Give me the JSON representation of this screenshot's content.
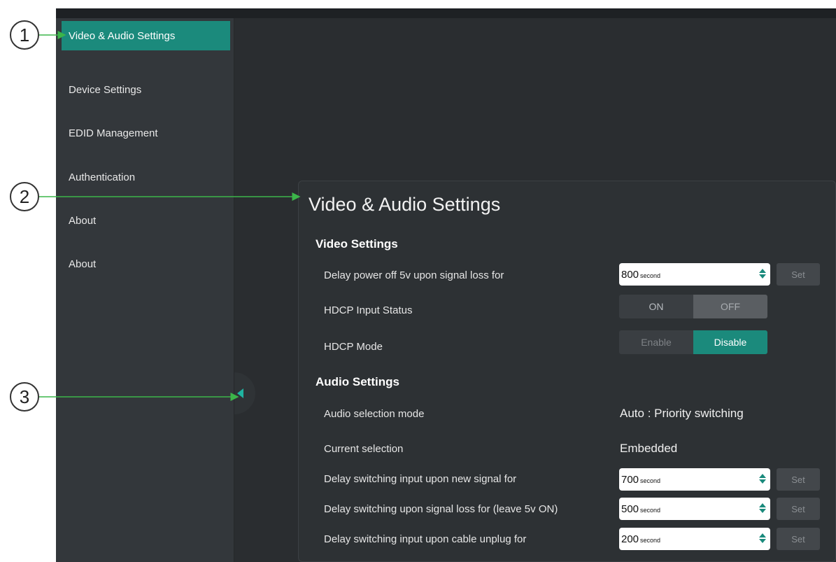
{
  "callouts": [
    "1",
    "2",
    "3"
  ],
  "sidebar": {
    "items": [
      {
        "label": "Video & Audio Settings"
      },
      {
        "label": "Device Settings"
      },
      {
        "label": "EDID Management"
      },
      {
        "label": "Authentication"
      },
      {
        "label": "About"
      },
      {
        "label": "About"
      }
    ]
  },
  "main": {
    "title": "Video & Audio Settings",
    "video": {
      "title": "Video Settings",
      "delay_power_off": {
        "label": "Delay power off 5v upon signal loss for",
        "value": "800",
        "unit": "second",
        "button": "Set"
      },
      "hdcp_input_status": {
        "label": "HDCP Input Status",
        "on": "ON",
        "off": "OFF"
      },
      "hdcp_mode": {
        "label": "HDCP Mode",
        "enable": "Enable",
        "disable": "Disable"
      }
    },
    "audio": {
      "title": "Audio Settings",
      "selection_mode": {
        "label": "Audio selection mode",
        "value": "Auto : Priority switching"
      },
      "current_selection": {
        "label": "Current selection",
        "value": "Embedded"
      },
      "delay_new_signal": {
        "label": "Delay switching input upon new signal for",
        "value": "700",
        "unit": "second",
        "button": "Set"
      },
      "delay_signal_loss": {
        "label": "Delay switching upon signal loss for (leave 5v ON)",
        "value": "500",
        "unit": "second",
        "button": "Set"
      },
      "delay_cable_unplug": {
        "label": "Delay switching input upon cable unplug for",
        "value": "200",
        "unit": "second",
        "button": "Set"
      }
    }
  },
  "colors": {
    "accent": "#1b8a7c",
    "callout_arrow": "#3cb54a",
    "sidebar_bg": "#33373b",
    "panel_bg": "#2d3134"
  },
  "icons": {
    "spinner": "updown-spinner-icon",
    "collapse": "collapse-sidebar-icon"
  }
}
